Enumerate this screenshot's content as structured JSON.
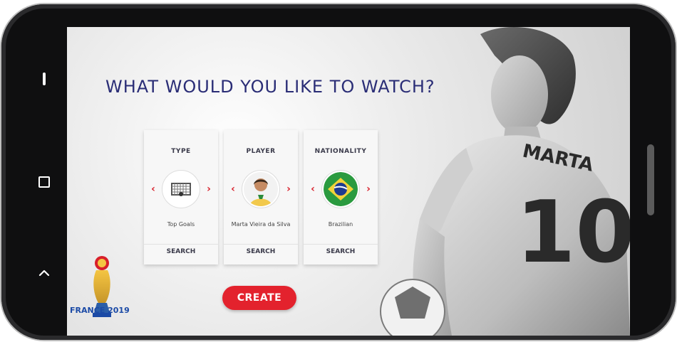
{
  "app": {
    "title": "WHAT WOULD YOU LIKE TO WATCH?",
    "create_label": "CREATE"
  },
  "cards": [
    {
      "title": "TYPE",
      "value": "Top Goals",
      "action": "SEARCH",
      "icon": "goal-net-icon"
    },
    {
      "title": "PLAYER",
      "value": "Marta Vieira da Silva",
      "action": "SEARCH",
      "icon": "player-avatar"
    },
    {
      "title": "NATIONALITY",
      "value": "Brazilian",
      "action": "SEARCH",
      "icon": "brazil-flag-icon"
    }
  ],
  "hero": {
    "name": "MARTA",
    "number": "10"
  },
  "logo": {
    "event": "FRANCE 2019"
  },
  "colors": {
    "title": "#2a2d76",
    "accent": "#e3222d",
    "chevron": "#d81f2a",
    "logo_blue": "#1b4aa6"
  },
  "device_nav": {
    "back_icon": "back-bar-icon",
    "home_icon": "home-square-icon",
    "recent_icon": "up-caret-icon"
  }
}
